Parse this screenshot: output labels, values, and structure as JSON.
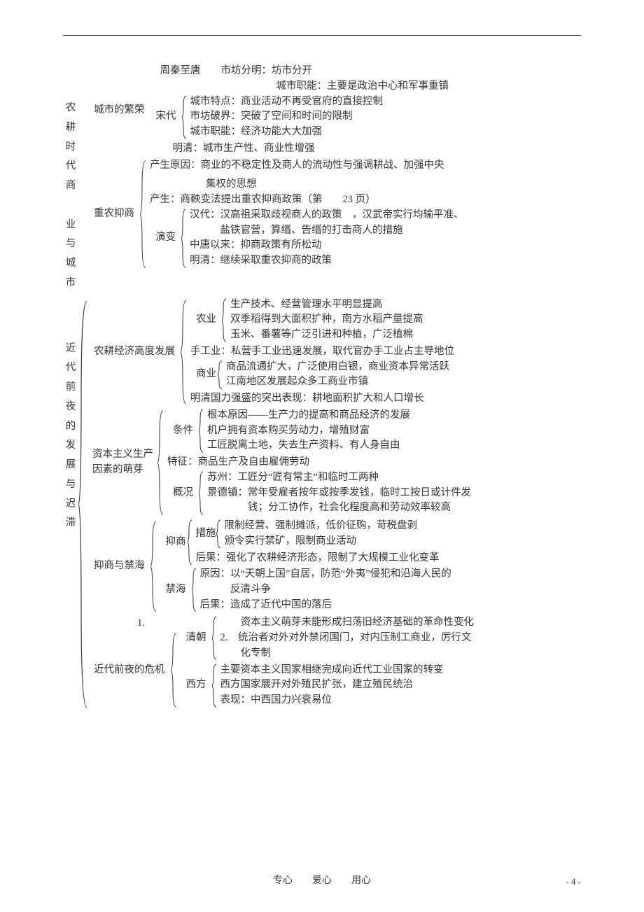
{
  "section1": {
    "vertical_label": [
      "农",
      "耕",
      "时",
      "代",
      "商",
      "",
      "业",
      "与",
      "城",
      "市"
    ],
    "sub1_label": "城市的繁荣",
    "zhou_tang_title": "周秦至唐　　市坊分明：坊市分开",
    "zhou_tang_line2": "城市职能：主要是政治中心和军事重镇",
    "song_label": "宋代",
    "song_lines": [
      "城市特点：商业活动不再受官府的直接控制",
      "市坊破界：突破了空间和时间的限制",
      "城市职能：经济功能大大加强"
    ],
    "mingqing_city": "明清：城市生产性、商业性增强",
    "sub2_label": "重农抑商",
    "origin_line": "产生原因：商业的不稳定性及商人的流动性与强调耕战、加强中央",
    "origin_line2": "集权的思想",
    "chansheng": "产生：商鞅变法提出重农抑商政策（第　　23 页）",
    "yanbian_label": "演变",
    "yanbian_lines": [
      "汉代：汉高祖采取歧视商人的政策　，汉武帝实行均输平准、",
      "　　　盐铁官营，算缗、告缗的打击商人的措施",
      "中唐以来：抑商政策有所松动",
      "明清：继续采取重农抑商的政策"
    ]
  },
  "section2": {
    "vertical_label": [
      "近",
      "代",
      "前",
      "夜",
      "的",
      "发",
      "展",
      "与",
      "迟",
      "滞"
    ],
    "sub1_label": "农耕经济高度发展",
    "nongye_label": "农业",
    "nongye_lines": [
      "生产技术、经营管理水平明显提高",
      "双季稻得到大面积扩种，南方水稻产量提高",
      "玉米、番薯等广泛引进和种植，广泛植棉"
    ],
    "shougong": "手工业：私营手工业迅速发展，取代官办手工业占主导地位",
    "shangye_label": "商业",
    "shangye_lines": [
      "商品流通扩大，广泛使用白银，商业资本异常活跃",
      "江南地区发展起众多工商业市镇"
    ],
    "mingqing_power": "明清国力强盛的突出表现：耕地面积扩大和人口增长",
    "sub2_label_l1": "资本主义生产",
    "sub2_label_l2": "因素的萌芽",
    "tiaojian_label": "条件",
    "tiaojian_lines": [
      "根本原因——生产力的提高和商品经济的发展",
      "机户拥有资本购买劳动力，增殖财富",
      "工匠脱离土地，失去生产资料、有人身自由"
    ],
    "tezheng": "特征：商品生产及自由雇佣劳动",
    "gaikuang_label": "概况",
    "gaikuang_lines": [
      "苏州：工匠分“匠有常主”和临时工两种",
      "景德镇：常年受雇者按年或按季发钱，临时工按日或计件发",
      "　　　　钱；分工协作，社会化程度高和劳动效率较高"
    ],
    "sub3_label": "抑商与禁海",
    "yishang_label": "抑商",
    "cuoshi_label": "措施",
    "cuoshi_lines": [
      "限制经营、强制摊派，低价征购，苛税盘剥",
      "颁令实行禁矿，限制商业活动"
    ],
    "yishang_houguo": "后果：强化了农耕经济形态，限制了大规模工业化变革",
    "jinhai_label": "禁海",
    "jinhai_lines": [
      "原因：以“天朝上国”自居，防范“外夷”侵犯和沿海人民的",
      "　　　反清斗争",
      "后果：造成了近代中国的落后"
    ],
    "num1": "1.",
    "sub4_label": "近代前夜的危机",
    "qingchao_label": "清朝",
    "qingchao_lines": [
      "　　资本主义萌芽未能形成扫荡旧经济基础的革命性变化",
      "2.　统治者对外对外禁闭国门，对内压制工商业，厉行文",
      "　　化专制"
    ],
    "xifang_label": "西方",
    "xifang_lines": [
      "主要资本主义国家相继完成向近代工业国家的转变",
      "西方国家展开对外殖民扩张，建立殖民统治",
      "表现：中西国力兴衰易位"
    ]
  },
  "footer": "专心　　爱心　　用心",
  "page_number": "- 4 -"
}
